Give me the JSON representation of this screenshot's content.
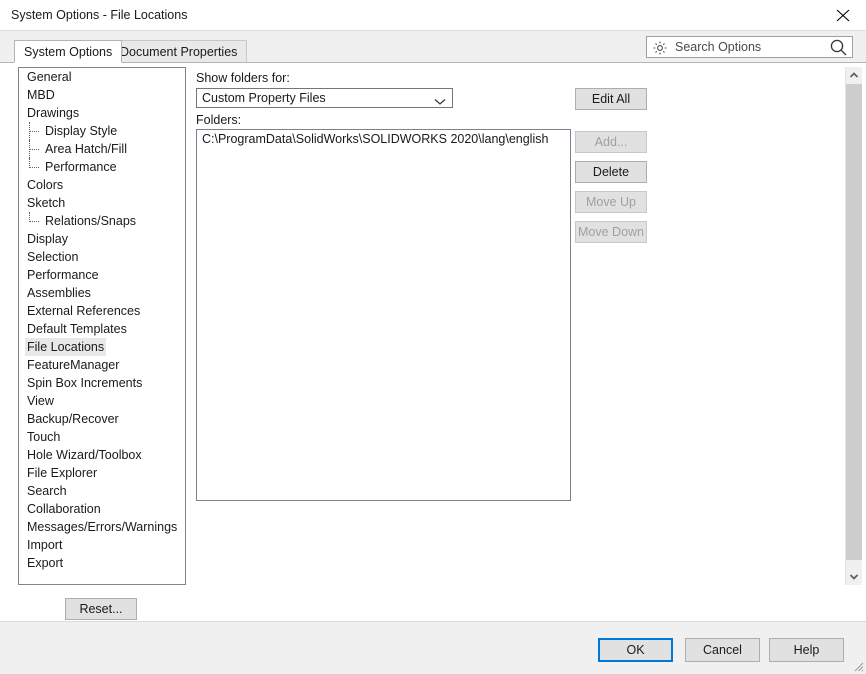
{
  "window": {
    "title": "System Options - File Locations",
    "close_icon": "close-icon"
  },
  "tabs": [
    {
      "label": "System Options",
      "active": true
    },
    {
      "label": "Document Properties",
      "active": false
    }
  ],
  "search": {
    "placeholder": "Search Options",
    "value": "",
    "gear_icon": "gear-icon",
    "magnifier_icon": "search-icon"
  },
  "sidebar": {
    "items": [
      {
        "label": "General",
        "level": 0,
        "selected": false
      },
      {
        "label": "MBD",
        "level": 0,
        "selected": false
      },
      {
        "label": "Drawings",
        "level": 0,
        "selected": false
      },
      {
        "label": "Display Style",
        "level": 1,
        "selected": false
      },
      {
        "label": "Area Hatch/Fill",
        "level": 1,
        "selected": false
      },
      {
        "label": "Performance",
        "level": 1,
        "selected": false,
        "last": true
      },
      {
        "label": "Colors",
        "level": 0,
        "selected": false
      },
      {
        "label": "Sketch",
        "level": 0,
        "selected": false
      },
      {
        "label": "Relations/Snaps",
        "level": 1,
        "selected": false,
        "last": true
      },
      {
        "label": "Display",
        "level": 0,
        "selected": false
      },
      {
        "label": "Selection",
        "level": 0,
        "selected": false
      },
      {
        "label": "Performance",
        "level": 0,
        "selected": false
      },
      {
        "label": "Assemblies",
        "level": 0,
        "selected": false
      },
      {
        "label": "External References",
        "level": 0,
        "selected": false
      },
      {
        "label": "Default Templates",
        "level": 0,
        "selected": false
      },
      {
        "label": "File Locations",
        "level": 0,
        "selected": true
      },
      {
        "label": "FeatureManager",
        "level": 0,
        "selected": false
      },
      {
        "label": "Spin Box Increments",
        "level": 0,
        "selected": false
      },
      {
        "label": "View",
        "level": 0,
        "selected": false
      },
      {
        "label": "Backup/Recover",
        "level": 0,
        "selected": false
      },
      {
        "label": "Touch",
        "level": 0,
        "selected": false
      },
      {
        "label": "Hole Wizard/Toolbox",
        "level": 0,
        "selected": false
      },
      {
        "label": "File Explorer",
        "level": 0,
        "selected": false
      },
      {
        "label": "Search",
        "level": 0,
        "selected": false
      },
      {
        "label": "Collaboration",
        "level": 0,
        "selected": false
      },
      {
        "label": "Messages/Errors/Warnings",
        "level": 0,
        "selected": false
      },
      {
        "label": "Import",
        "level": 0,
        "selected": false
      },
      {
        "label": "Export",
        "level": 0,
        "selected": false
      }
    ]
  },
  "main": {
    "show_folders_label": "Show folders for:",
    "folders_label": "Folders:",
    "folder_type": {
      "selected": "Custom Property Files",
      "chevron_icon": "chevron-down-icon"
    },
    "folders": [
      "C:\\ProgramData\\SolidWorks\\SOLIDWORKS 2020\\lang\\english"
    ],
    "buttons": {
      "edit_all": {
        "label": "Edit All",
        "enabled": true
      },
      "add": {
        "label": "Add...",
        "enabled": false
      },
      "delete": {
        "label": "Delete",
        "enabled": true
      },
      "move_up": {
        "label": "Move Up",
        "enabled": false
      },
      "move_down": {
        "label": "Move Down",
        "enabled": false
      }
    }
  },
  "footer": {
    "reset": "Reset...",
    "ok": "OK",
    "cancel": "Cancel",
    "help": "Help"
  },
  "colors": {
    "accent": "#0078d7",
    "dialog_bg": "#f0f0f0",
    "panel_bg": "#ffffff",
    "selection": "#e8e8e8",
    "scrollbar_thumb": "#cdcdcd"
  }
}
